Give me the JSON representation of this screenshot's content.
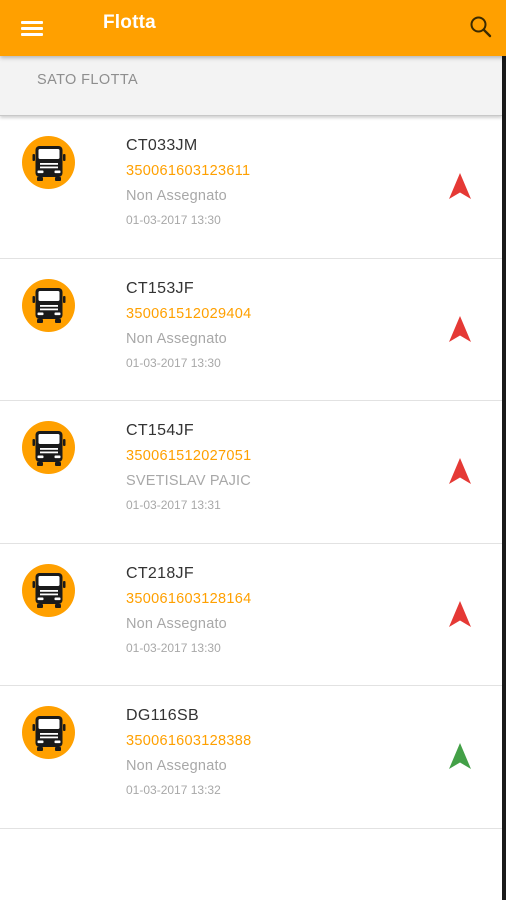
{
  "app": {
    "title": "Flotta",
    "accent": "#FFA000",
    "menu_icon": "hamburger-menu-icon",
    "search_icon": "search-icon"
  },
  "section": {
    "label": "SATO FLOTTA"
  },
  "vehicles": [
    {
      "plate": "CT033JM",
      "imei": "350061603123611",
      "driver": "Non Assegnato",
      "timestamp": "01-03-2017 13:30",
      "status": "red",
      "status_color": "#E53935"
    },
    {
      "plate": "CT153JF",
      "imei": "350061512029404",
      "driver": "Non Assegnato",
      "timestamp": "01-03-2017 13:30",
      "status": "red",
      "status_color": "#E53935"
    },
    {
      "plate": "CT154JF",
      "imei": "350061512027051",
      "driver": "SVETISLAV PAJIC",
      "timestamp": "01-03-2017 13:31",
      "status": "red",
      "status_color": "#E53935"
    },
    {
      "plate": "CT218JF",
      "imei": "350061603128164",
      "driver": "Non Assegnato",
      "timestamp": "01-03-2017 13:30",
      "status": "red",
      "status_color": "#E53935"
    },
    {
      "plate": "DG116SB",
      "imei": "350061603128388",
      "driver": "Non Assegnato",
      "timestamp": "01-03-2017 13:32",
      "status": "green",
      "status_color": "#43A047"
    }
  ]
}
